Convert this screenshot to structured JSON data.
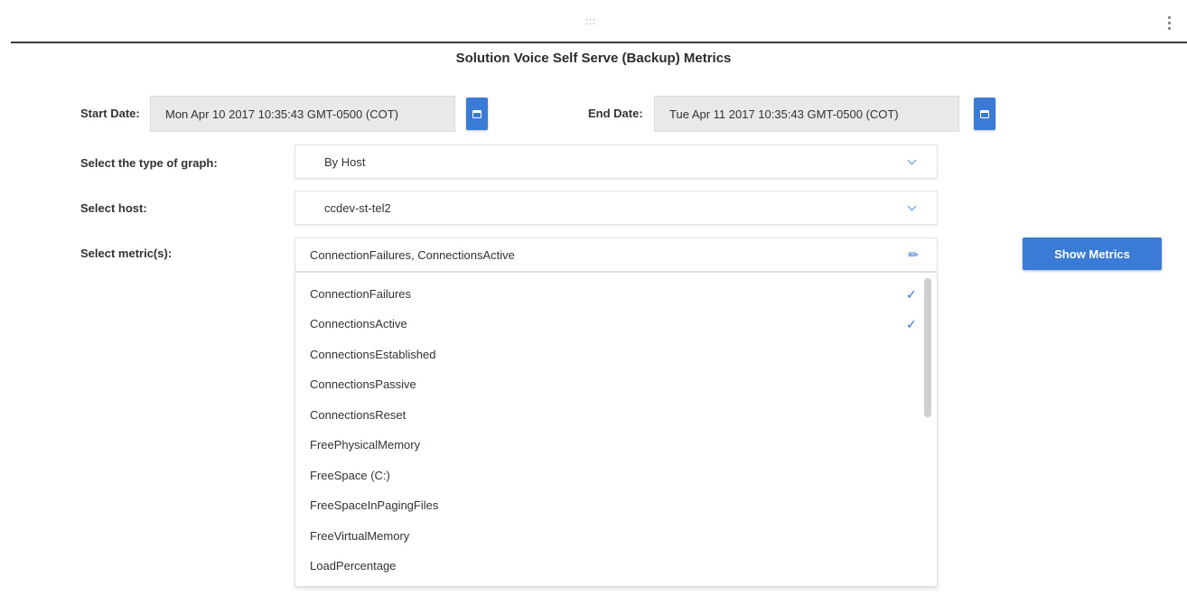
{
  "window": {
    "drag_handle": ":::"
  },
  "page": {
    "title": "Solution Voice Self Serve (Backup) Metrics"
  },
  "form": {
    "start_date": {
      "label": "Start Date:",
      "value": "Mon Apr 10 2017 10:35:43 GMT-0500 (COT)",
      "icon": "calendar-icon"
    },
    "end_date": {
      "label": "End Date:",
      "value": "Tue Apr 11 2017 10:35:43 GMT-0500 (COT)",
      "icon": "calendar-icon"
    },
    "graph_type": {
      "label": "Select the type of graph:",
      "value": "By Host",
      "icon": "chevron-down-icon"
    },
    "host": {
      "label": "Select host:",
      "value": "ccdev-st-tel2",
      "icon": "chevron-down-icon"
    },
    "metrics": {
      "label": "Select metric(s):",
      "value": "ConnectionFailures, ConnectionsActive",
      "icon": "pencil-icon",
      "options": [
        {
          "label": "ConnectionFailures",
          "selected": true
        },
        {
          "label": "ConnectionsActive",
          "selected": true
        },
        {
          "label": "ConnectionsEstablished",
          "selected": false
        },
        {
          "label": "ConnectionsPassive",
          "selected": false
        },
        {
          "label": "ConnectionsReset",
          "selected": false
        },
        {
          "label": "FreePhysicalMemory",
          "selected": false
        },
        {
          "label": "FreeSpace (C:)",
          "selected": false
        },
        {
          "label": "FreeSpaceInPagingFiles",
          "selected": false
        },
        {
          "label": "FreeVirtualMemory",
          "selected": false
        },
        {
          "label": "LoadPercentage",
          "selected": false
        }
      ],
      "check_glyph": "✓"
    }
  },
  "actions": {
    "show_metrics": "Show Metrics"
  },
  "colors": {
    "accent": "#3a7bd5",
    "field_bg": "#e9e9e9",
    "check": "#2e6fd0"
  }
}
